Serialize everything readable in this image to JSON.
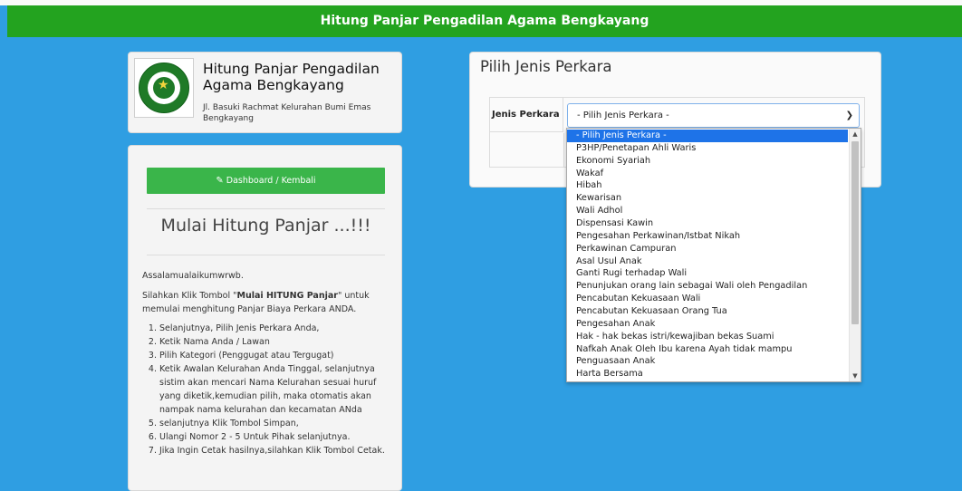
{
  "app": {
    "header_title": "Hitung Panjar Pengadilan Agama Bengkayang"
  },
  "logo_card": {
    "title": "Hitung Panjar Pengadilan Agama Bengkayang",
    "address": "Jl. Basuki Rachmat Kelurahan Bumi Emas Bengkayang",
    "logo_icon": "court-emblem-icon"
  },
  "left_panel": {
    "dashboard_button": "Dashboard / Kembali",
    "dashboard_icon": "edit-icon",
    "heading": "Mulai Hitung Panjar ...!!!",
    "greeting": "Assalamualaikumwrwb.",
    "instruction_prefix": "Silahkan Klik Tombol \"",
    "instruction_bold": "Mulai HITUNG Panjar",
    "instruction_suffix": "\" untuk memulai menghitung Panjar Biaya Perkara ANDA.",
    "steps": [
      "Selanjutnya, Pilih Jenis Perkara Anda,",
      "Ketik Nama Anda / Lawan",
      "Pilih Kategori (Penggugat atau Tergugat)",
      "Ketik Awalan Kelurahan Anda Tinggal, selanjutnya sistim akan mencari Nama Kelurahan sesuai huruf yang diketik,kemudian pilih, maka otomatis akan nampak nama kelurahan dan kecamatan ANda",
      "selanjutnya Klik Tombol Simpan,",
      "Ulangi Nomor 2 - 5 Untuk Pihak selanjutnya.",
      "Jika Ingin Cetak hasilnya,silahkan Klik Tombol Cetak."
    ]
  },
  "right_panel": {
    "title": "Pilih Jenis Perkara",
    "field_label": "Jenis Perkara",
    "selected_value": "- Pilih Jenis Perkara -",
    "chevron_icon": "chevron-down-icon"
  },
  "dropdown": {
    "options": [
      "- Pilih Jenis Perkara -",
      "P3HP/Penetapan Ahli Waris",
      "Ekonomi Syariah",
      "Wakaf",
      "Hibah",
      "Kewarisan",
      "Wali Adhol",
      "Dispensasi Kawin",
      "Pengesahan Perkawinan/Istbat Nikah",
      "Perkawinan Campuran",
      "Asal Usul Anak",
      "Ganti Rugi terhadap Wali",
      "Penunjukan orang lain sebagai Wali oleh Pengadilan",
      "Pencabutan Kekuasaan Wali",
      "Pencabutan Kekuasaan Orang Tua",
      "Pengesahan Anak",
      "Hak - hak bekas istri/kewajiban bekas Suami",
      "Nafkah Anak Oleh Ibu karena Ayah tidak mampu",
      "Penguasaan Anak",
      "Harta Bersama"
    ],
    "selected_index": 0
  },
  "colors": {
    "header_bg": "#23a31f",
    "page_bg": "#2f9ee2",
    "button_green": "#3ab54a",
    "selected_option": "#1e73e8"
  }
}
